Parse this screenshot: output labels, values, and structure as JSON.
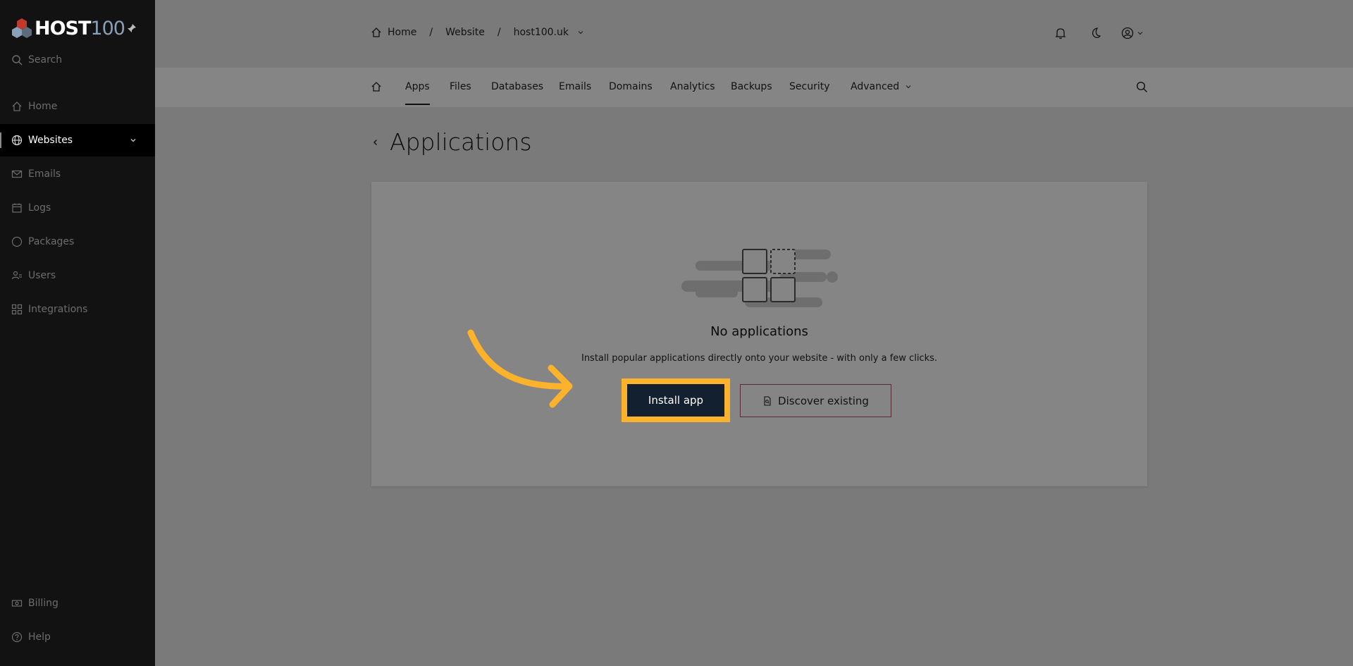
{
  "brand": {
    "name_part1": "HOST",
    "name_part2": "100"
  },
  "sidebar": {
    "search_label": "Search",
    "items": [
      {
        "label": "Home",
        "icon": "home-icon"
      },
      {
        "label": "Websites",
        "icon": "globe-icon",
        "active": true
      },
      {
        "label": "Emails",
        "icon": "mail-icon"
      },
      {
        "label": "Logs",
        "icon": "calendar-icon"
      },
      {
        "label": "Packages",
        "icon": "circle-icon"
      },
      {
        "label": "Users",
        "icon": "users-icon"
      },
      {
        "label": "Integrations",
        "icon": "grid-icon"
      }
    ],
    "bottom_items": [
      {
        "label": "Billing",
        "icon": "money-icon"
      },
      {
        "label": "Help",
        "icon": "help-icon"
      }
    ]
  },
  "breadcrumb": {
    "home": "Home",
    "section": "Website",
    "site": "host100.uk"
  },
  "tabs": [
    "Apps",
    "Files",
    "Databases",
    "Emails",
    "Domains",
    "Analytics",
    "Backups",
    "Security",
    "Advanced"
  ],
  "page": {
    "title": "Applications",
    "empty_title": "No applications",
    "empty_description": "Install popular applications directly onto your website - with only a few clicks.",
    "install_button": "Install app",
    "discover_button": "Discover existing"
  },
  "colors": {
    "highlight": "#fdb22b",
    "primary_button": "#13202f",
    "sidebar_bg": "#121212"
  }
}
